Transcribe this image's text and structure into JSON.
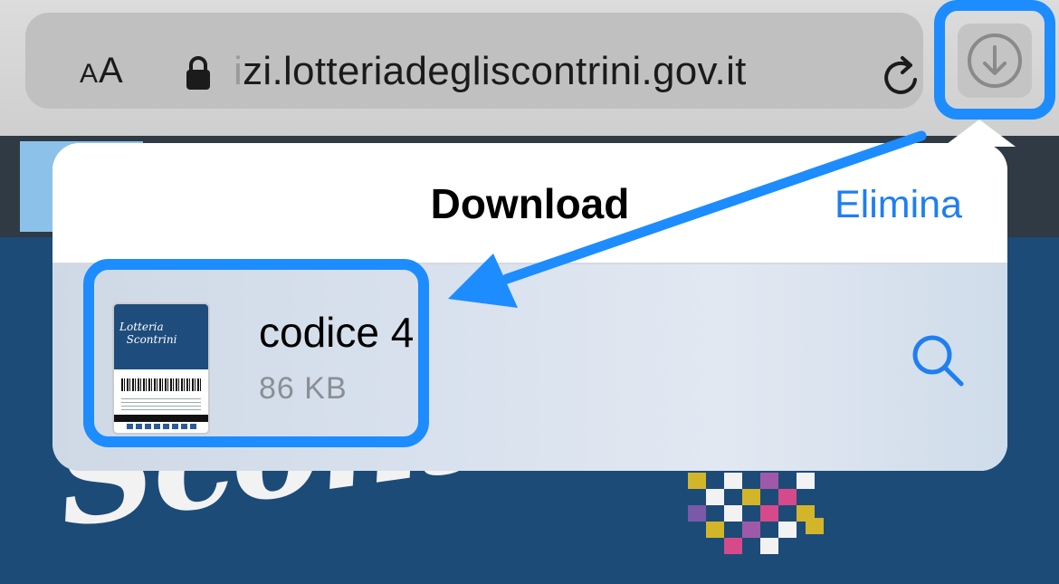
{
  "address_bar": {
    "text_size_label": "AA",
    "url_faded_prefix": "i",
    "url_main": "zi.lotteriadegliscontrini.gov.it",
    "lock_icon": "lock-icon",
    "reload_icon": "reload-icon",
    "download_icon": "download-arrow-circle-icon"
  },
  "downloads_popover": {
    "title": "Download",
    "clear_label": "Elimina",
    "items": [
      {
        "name": "codice 4",
        "size": "86 KB",
        "thumbnail_brand": "Lotteria degli Scontrini",
        "action_icon": "magnifier-icon"
      }
    ]
  },
  "background_site": {
    "script_text": "Scontrini"
  },
  "colors": {
    "annotation_blue": "#1d8cff",
    "link_blue": "#1f7ff0",
    "site_blue": "#1d4b78"
  }
}
